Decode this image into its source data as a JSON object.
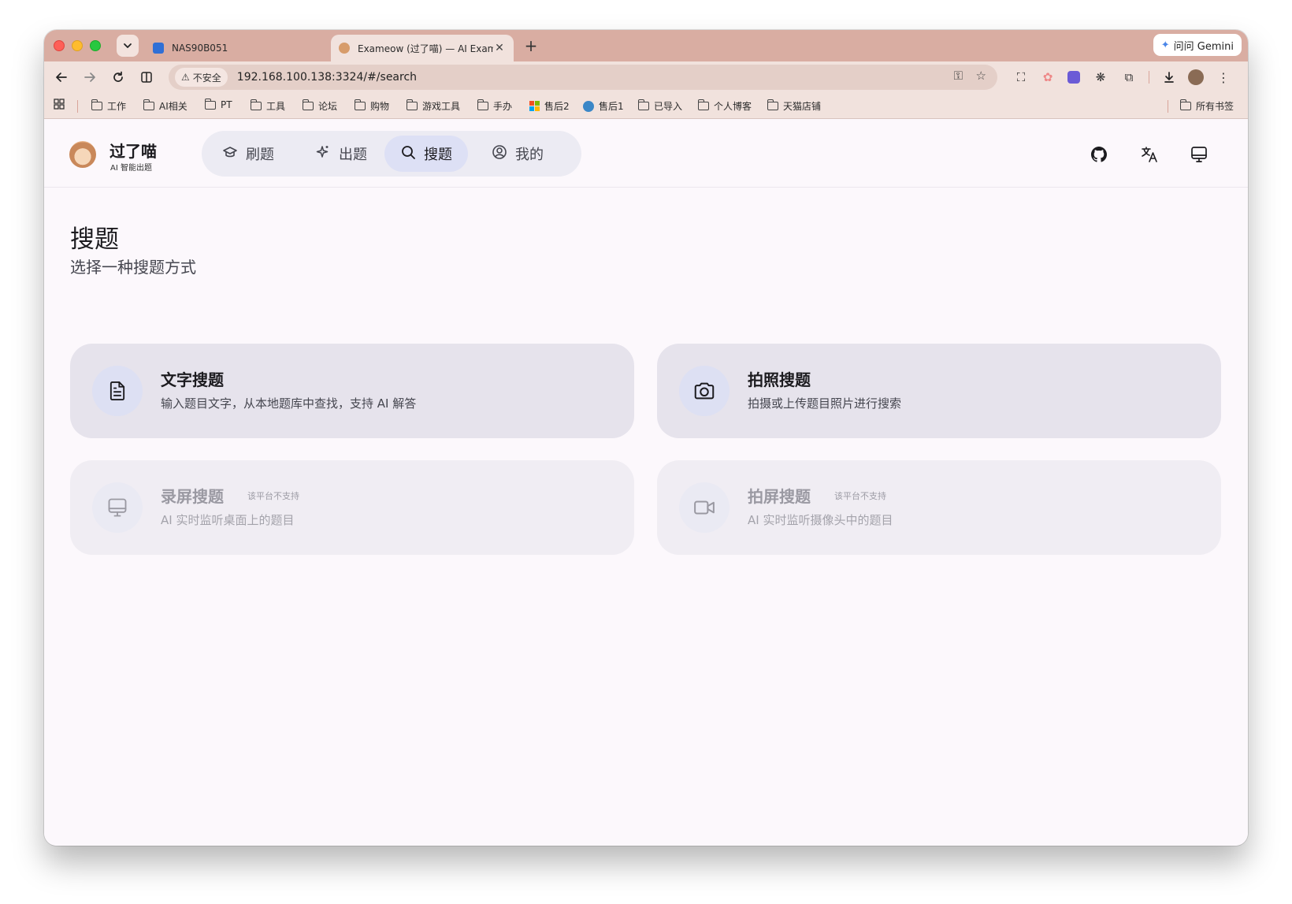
{
  "browser": {
    "tab_search_icon": "chevron-down-icon",
    "tabs": [
      {
        "title": "NAS90B051",
        "favicon": "nas-favicon"
      },
      {
        "title": "Exameow (过了喵) — AI Exam",
        "favicon": "cat-favicon"
      }
    ],
    "gemini_label": "问问 Gemini",
    "security_label": "不安全",
    "url": "192.168.100.138:3324/#/search",
    "bookmarks": [
      "工作",
      "AI相关",
      "PT",
      "工具",
      "论坛",
      "购物",
      "游戏工具",
      "手办",
      "售后2",
      "售后1",
      "已导入",
      "个人博客",
      "天猫店铺"
    ],
    "all_bookmarks_label": "所有书签"
  },
  "app": {
    "logo_title": "过了喵",
    "logo_subtitle": "AI 智能出题",
    "nav": [
      {
        "label": "刷题",
        "icon": "graduation-cap-icon"
      },
      {
        "label": "出题",
        "icon": "sparkles-icon"
      },
      {
        "label": "搜题",
        "icon": "search-icon",
        "active": true
      },
      {
        "label": "我的",
        "icon": "user-circle-icon"
      }
    ],
    "header_icons": [
      "github-icon",
      "translate-icon",
      "monitor-icon"
    ]
  },
  "page": {
    "title": "搜题",
    "subtitle": "选择一种搜题方式",
    "cards": [
      {
        "title": "文字搜题",
        "desc": "输入题目文字，从本地题库中查找，支持 AI 解答",
        "icon": "file-text-icon",
        "disabled": false
      },
      {
        "title": "拍照搜题",
        "desc": "拍摄或上传题目照片进行搜索",
        "icon": "camera-icon",
        "disabled": false
      },
      {
        "title": "录屏搜题",
        "desc": "AI 实时监听桌面上的题目",
        "icon": "monitor-icon",
        "disabled": true,
        "badge": "该平台不支持"
      },
      {
        "title": "拍屏搜题",
        "desc": "AI 实时监听摄像头中的题目",
        "icon": "video-camera-icon",
        "disabled": true,
        "badge": "该平台不支持"
      }
    ]
  },
  "colors": {
    "tabstrip": "#d9ada2",
    "toolbar": "#f1e2dd",
    "app_bg": "#fcf8fc",
    "nav_pill": "#ecebf3",
    "nav_active": "#dde0f5",
    "card": "#e6e3ec",
    "card_disabled": "#f0edf3"
  }
}
